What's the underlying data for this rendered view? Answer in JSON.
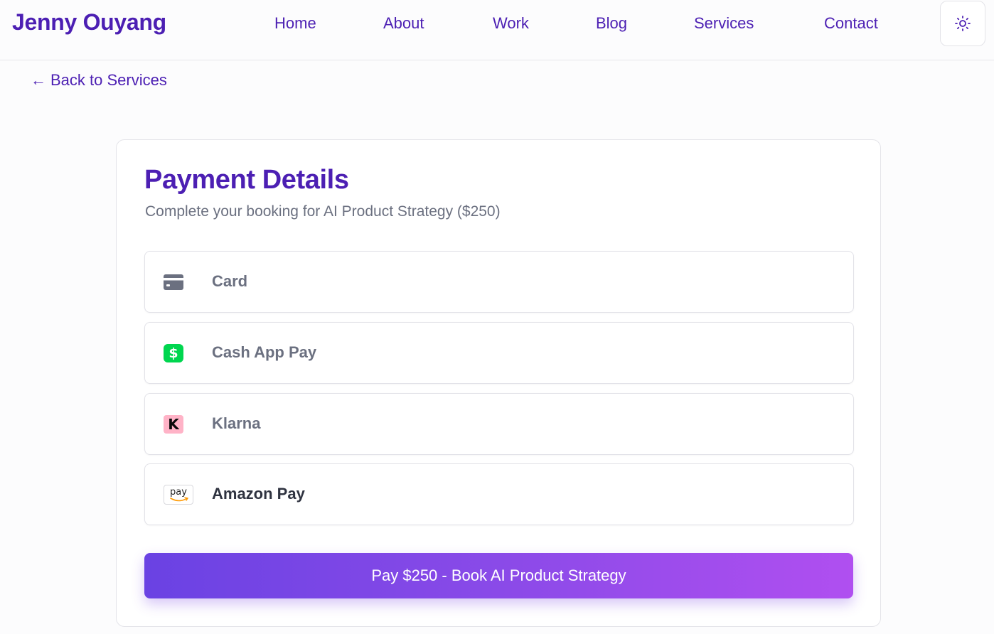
{
  "header": {
    "brand": "Jenny Ouyang",
    "nav": [
      {
        "label": "Home",
        "icon": ""
      },
      {
        "label": "About"
      },
      {
        "label": "Work"
      },
      {
        "label": "Blog"
      },
      {
        "label": "Services"
      },
      {
        "label": "Contact"
      }
    ],
    "theme_toggle_icon": "sun-icon"
  },
  "back_link": {
    "arrow": "←",
    "label": "Back to Services"
  },
  "payment": {
    "title": "Payment Details",
    "subtitle": "Complete your booking for AI Product Strategy ($250)",
    "methods": [
      {
        "label": "Card",
        "icon": "credit-card-icon",
        "selected": false
      },
      {
        "label": "Cash App Pay",
        "icon": "cash-app-icon",
        "glyph": "$",
        "color": "#00d64f",
        "selected": false
      },
      {
        "label": "Klarna",
        "icon": "klarna-icon",
        "glyph": "K",
        "color": "#ffb3c7",
        "selected": false
      },
      {
        "label": "Amazon Pay",
        "icon": "amazon-pay-icon",
        "glyph": "pay",
        "selected": true
      }
    ],
    "pay_button": "Pay $250 - Book AI Product Strategy"
  },
  "colors": {
    "brand": "#4c1fb3",
    "muted_text": "#6b7080",
    "button_gradient_start": "#6a42e3",
    "button_gradient_end": "#b04ff0"
  }
}
